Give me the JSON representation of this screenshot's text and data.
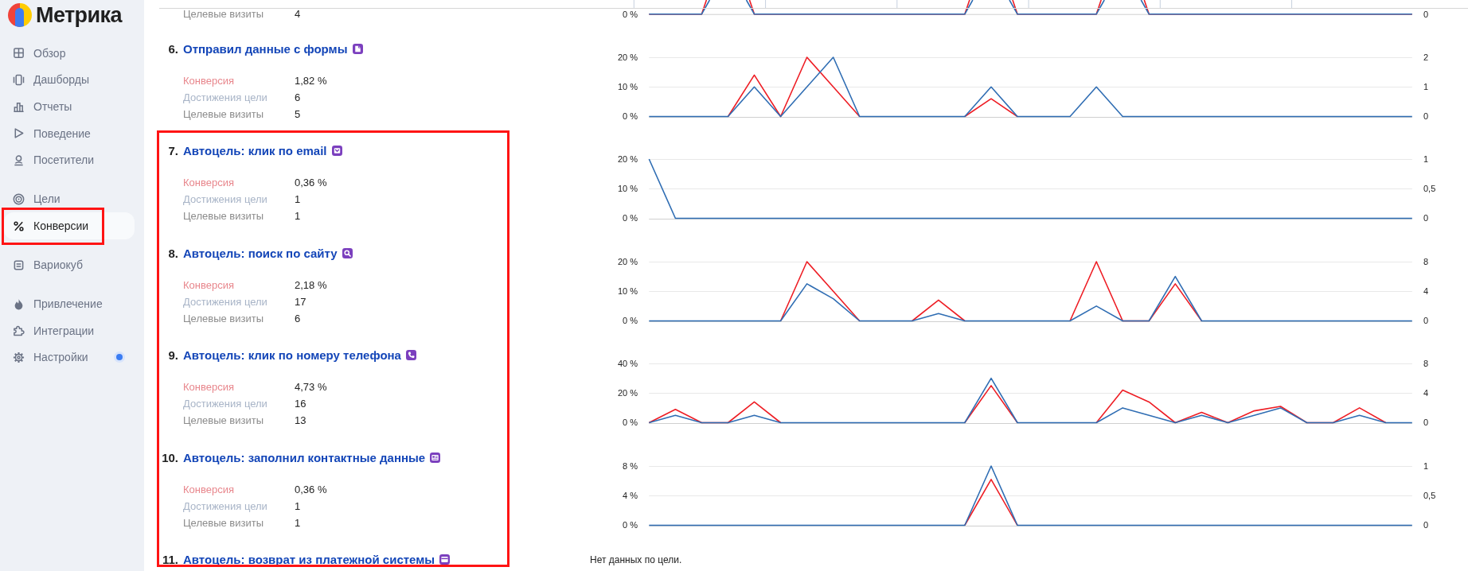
{
  "sidebar": {
    "logo": {
      "title": "Метрика"
    },
    "groups": [
      {
        "items": [
          {
            "label": "Обзор",
            "selected": false,
            "annotated": false,
            "notification": false
          },
          {
            "label": "Дашборды",
            "selected": false,
            "annotated": false,
            "notification": false
          },
          {
            "label": "Отчеты",
            "selected": false,
            "annotated": false,
            "notification": false
          },
          {
            "label": "Поведение",
            "selected": false,
            "annotated": false,
            "notification": false
          },
          {
            "label": "Посетители",
            "selected": false,
            "annotated": false,
            "notification": false
          }
        ]
      },
      {
        "items": [
          {
            "label": "Цели",
            "selected": false,
            "annotated": false,
            "notification": false
          },
          {
            "label": "Конверсии",
            "selected": true,
            "annotated": true,
            "notification": false
          }
        ]
      },
      {
        "items": [
          {
            "label": "Вариокуб",
            "selected": false,
            "annotated": false,
            "notification": false
          }
        ]
      },
      {
        "items": [
          {
            "label": "Привлечение",
            "selected": false,
            "annotated": false,
            "notification": false
          },
          {
            "label": "Интеграции",
            "selected": false,
            "annotated": false,
            "notification": false
          },
          {
            "label": "Настройки",
            "selected": false,
            "annotated": false,
            "notification": true
          }
        ]
      }
    ]
  },
  "goals": [
    {
      "kind": "partial",
      "annotated": false,
      "metrics": [
        {
          "label": "Целевые визиты",
          "value": "4",
          "color": "#8c8c8c"
        }
      ],
      "chart_fragment": {
        "y_label": "0 %",
        "y2_label": "0"
      }
    },
    {
      "kind": "chart",
      "number": "6.",
      "title": "Отправил данные с формы",
      "annotated": false,
      "metrics": [
        {
          "label": "Конверсия",
          "value": "1,82 %",
          "color": "#e8878d"
        },
        {
          "label": "Достижения цели",
          "value": "6",
          "color": "#a8b4c7"
        },
        {
          "label": "Целевые визиты",
          "value": "5",
          "color": "#8c8c8c"
        }
      ],
      "chart_data": {
        "type": "line",
        "ylim": [
          0,
          20
        ],
        "yticks": [
          {
            "value": 0,
            "label": "0 %"
          },
          {
            "value": 10,
            "label": "10 %"
          },
          {
            "value": 20,
            "label": "20 %"
          }
        ],
        "y2lim": [
          0,
          2
        ],
        "y2ticks": [
          0,
          1,
          2
        ],
        "series": [
          {
            "color": "#ee1d24",
            "values": [
              null,
              null,
              null,
              0,
              14,
              0,
              20,
              10,
              0,
              null,
              null,
              null,
              0,
              6,
              0,
              null,
              null,
              null,
              null,
              null,
              null,
              null,
              null,
              null,
              null,
              null,
              null,
              null,
              null,
              null
            ]
          },
          {
            "color": "#2f6db3",
            "axis": "y2",
            "values": [
              0,
              0,
              0,
              0,
              1,
              0,
              1,
              2,
              0,
              0,
              0,
              0,
              0,
              1,
              0,
              0,
              0,
              1,
              0,
              0,
              0,
              0,
              0,
              0,
              0,
              0,
              0,
              0,
              0,
              0
            ]
          }
        ]
      }
    },
    {
      "kind": "chart",
      "number": "7.",
      "title": "Автоцель: клик по email",
      "annotated": true,
      "metrics": [
        {
          "label": "Конверсия",
          "value": "0,36 %",
          "color": "#e8878d"
        },
        {
          "label": "Достижения цели",
          "value": "1",
          "color": "#a8b4c7"
        },
        {
          "label": "Целевые визиты",
          "value": "1",
          "color": "#8c8c8c"
        }
      ],
      "chart_data": {
        "type": "line",
        "ylim": [
          0,
          20
        ],
        "yticks": [
          {
            "value": 0,
            "label": "0 %"
          },
          {
            "value": 10,
            "label": "10 %"
          },
          {
            "value": 20,
            "label": "20 %"
          }
        ],
        "y2lim": [
          0,
          1
        ],
        "y2ticks": [
          0,
          {
            "value": 0.5,
            "label": "0,5"
          },
          1
        ],
        "series": [
          {
            "color": "#2f6db3",
            "axis": "y2",
            "values": [
              1,
              0,
              0,
              0,
              0,
              0,
              0,
              0,
              0,
              0,
              0,
              0,
              0,
              0,
              0,
              0,
              0,
              0,
              0,
              0,
              0,
              0,
              0,
              0,
              0,
              0,
              0,
              0,
              0,
              0
            ]
          }
        ]
      }
    },
    {
      "kind": "chart",
      "number": "8.",
      "title": "Автоцель: поиск по сайту",
      "annotated": true,
      "metrics": [
        {
          "label": "Конверсия",
          "value": "2,18 %",
          "color": "#e8878d"
        },
        {
          "label": "Достижения цели",
          "value": "17",
          "color": "#a8b4c7"
        },
        {
          "label": "Целевые визиты",
          "value": "6",
          "color": "#8c8c8c"
        }
      ],
      "chart_data": {
        "type": "line",
        "ylim": [
          0,
          20
        ],
        "yticks": [
          {
            "value": 0,
            "label": "0 %"
          },
          {
            "value": 10,
            "label": "10 %"
          },
          {
            "value": 20,
            "label": "20 %"
          }
        ],
        "y2lim": [
          0,
          8
        ],
        "y2ticks": [
          0,
          4,
          8
        ],
        "series": [
          {
            "color": "#ee1d24",
            "values": [
              null,
              null,
              null,
              null,
              null,
              0,
              20,
              10,
              0,
              null,
              0,
              7,
              0,
              null,
              null,
              null,
              0,
              20,
              0,
              0,
              12.5,
              0,
              null,
              null,
              null,
              null,
              null,
              null,
              null,
              null
            ]
          },
          {
            "color": "#2f6db3",
            "axis": "y2",
            "values": [
              0,
              0,
              0,
              0,
              0,
              0,
              5,
              3,
              0,
              0,
              0,
              1,
              0,
              0,
              0,
              0,
              0,
              2,
              0,
              0,
              6,
              0,
              0,
              0,
              0,
              0,
              0,
              0,
              0,
              0
            ]
          }
        ]
      }
    },
    {
      "kind": "chart",
      "number": "9.",
      "title": "Автоцель: клик по номеру телефона",
      "annotated": true,
      "metrics": [
        {
          "label": "Конверсия",
          "value": "4,73 %",
          "color": "#e8878d"
        },
        {
          "label": "Достижения цели",
          "value": "16",
          "color": "#a8b4c7"
        },
        {
          "label": "Целевые визиты",
          "value": "13",
          "color": "#8c8c8c"
        }
      ],
      "chart_data": {
        "type": "line",
        "ylim": [
          0,
          40
        ],
        "yticks": [
          {
            "value": 0,
            "label": "0 %"
          },
          {
            "value": 20,
            "label": "20 %"
          },
          {
            "value": 40,
            "label": "40 %"
          }
        ],
        "y2lim": [
          0,
          8
        ],
        "y2ticks": [
          0,
          4,
          8
        ],
        "series": [
          {
            "color": "#ee1d24",
            "values": [
              0,
              9,
              0,
              0,
              14,
              0,
              null,
              null,
              null,
              null,
              null,
              null,
              0,
              25,
              0,
              null,
              null,
              0,
              22,
              14,
              0,
              7,
              0,
              8,
              11,
              0,
              0,
              10,
              0,
              null
            ]
          },
          {
            "color": "#2f6db3",
            "axis": "y2",
            "values": [
              0,
              1,
              0,
              0,
              1,
              0,
              0,
              0,
              0,
              0,
              0,
              0,
              0,
              6,
              0,
              0,
              0,
              0,
              2,
              1,
              0,
              1,
              0,
              1,
              2,
              0,
              0,
              1,
              0,
              0
            ]
          }
        ]
      }
    },
    {
      "kind": "chart",
      "number": "10.",
      "title": "Автоцель: заполнил контактные данные",
      "annotated": true,
      "metrics": [
        {
          "label": "Конверсия",
          "value": "0,36 %",
          "color": "#e8878d"
        },
        {
          "label": "Достижения цели",
          "value": "1",
          "color": "#a8b4c7"
        },
        {
          "label": "Целевые визиты",
          "value": "1",
          "color": "#8c8c8c"
        }
      ],
      "chart_data": {
        "type": "line",
        "ylim": [
          0,
          8
        ],
        "yticks": [
          {
            "value": 0,
            "label": "0 %"
          },
          {
            "value": 4,
            "label": "4 %"
          },
          {
            "value": 8,
            "label": "8 %"
          }
        ],
        "y2lim": [
          0,
          1
        ],
        "y2ticks": [
          0,
          {
            "value": 0.5,
            "label": "0,5"
          },
          1
        ],
        "series": [
          {
            "color": "#ee1d24",
            "values": [
              null,
              null,
              null,
              null,
              null,
              null,
              null,
              null,
              null,
              null,
              null,
              null,
              0,
              6.2,
              0,
              null,
              null,
              null,
              null,
              null,
              null,
              null,
              null,
              null,
              null,
              null,
              null,
              null,
              null,
              null
            ]
          },
          {
            "color": "#2f6db3",
            "axis": "y2",
            "values": [
              0,
              0,
              0,
              0,
              0,
              0,
              0,
              0,
              0,
              0,
              0,
              0,
              0,
              1,
              0,
              0,
              0,
              0,
              0,
              0,
              0,
              0,
              0,
              0,
              0,
              0,
              0,
              0,
              0,
              0
            ]
          }
        ]
      }
    },
    {
      "kind": "no_data",
      "number": "11.",
      "title": "Автоцель: возврат из платежной системы",
      "annotated": true,
      "message": "Нет данных по цели."
    }
  ]
}
